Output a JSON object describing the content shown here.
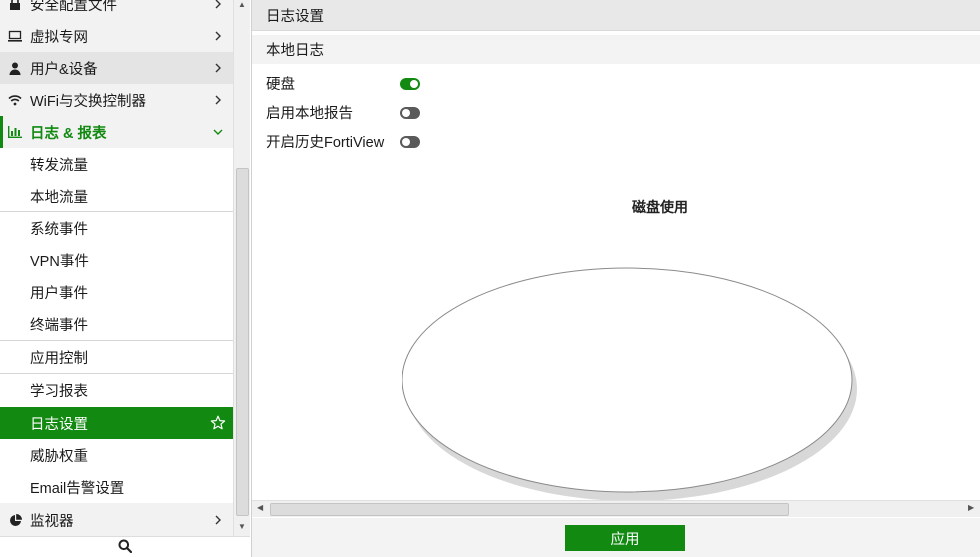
{
  "sidebar": {
    "top_items": [
      {
        "label": "安全配置文件",
        "icon": "lock-icon"
      },
      {
        "label": "虚拟专网",
        "icon": "monitor-icon"
      },
      {
        "label": "用户&设备",
        "icon": "user-icon"
      },
      {
        "label": "WiFi与交换控制器",
        "icon": "wifi-icon"
      },
      {
        "label": "日志 & 报表",
        "icon": "bar-chart-icon"
      }
    ],
    "sub_items": [
      {
        "label": "转发流量"
      },
      {
        "label": "本地流量"
      },
      {
        "label": "系统事件"
      },
      {
        "label": "VPN事件"
      },
      {
        "label": "用户事件"
      },
      {
        "label": "终端事件"
      },
      {
        "label": "应用控制"
      },
      {
        "label": "学习报表"
      },
      {
        "label": "日志设置"
      },
      {
        "label": "威胁权重"
      },
      {
        "label": "Email告警设置"
      }
    ],
    "bottom_item": {
      "label": "监视器",
      "icon": "pie-chart-icon"
    }
  },
  "main": {
    "page_title": "日志设置",
    "section_title": "本地日志",
    "settings": [
      {
        "label": "硬盘",
        "enabled": true
      },
      {
        "label": "启用本地报告",
        "enabled": false
      },
      {
        "label": "开启历史FortiView",
        "enabled": false
      }
    ],
    "chart_title": "磁盘使用",
    "apply_label": "应用"
  },
  "chart_data": {
    "type": "pie",
    "title": "磁盘使用",
    "categories": [],
    "values": []
  },
  "colors": {
    "accent": "#128a12",
    "toggle_off": "#5a5a5a"
  }
}
